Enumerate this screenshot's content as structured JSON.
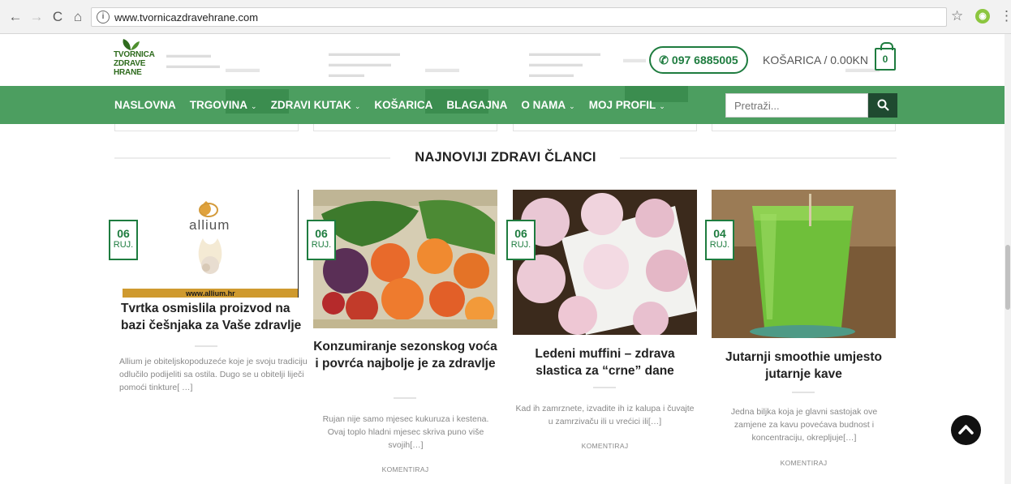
{
  "browser": {
    "url": "www.tvornicazdravehrane.com"
  },
  "header": {
    "logo_lines": [
      "TVORNICA",
      "ZDRAVE",
      "HRANE"
    ],
    "phone": "097 6885005",
    "cart_label": "KOŠARICA / 0.00KN",
    "cart_count": "0"
  },
  "nav": {
    "items": [
      {
        "label": "NASLOVNA",
        "dropdown": false
      },
      {
        "label": "TRGOVINA",
        "dropdown": true
      },
      {
        "label": "ZDRAVI KUTAK",
        "dropdown": true
      },
      {
        "label": "KOŠARICA",
        "dropdown": false
      },
      {
        "label": "BLAGAJNA",
        "dropdown": false
      },
      {
        "label": "O NAMA",
        "dropdown": true
      },
      {
        "label": "MOJ PROFIL",
        "dropdown": true
      }
    ],
    "search_placeholder": "Pretraži..."
  },
  "section": {
    "title": "NAJNOVIJI ZDRAVI ČLANCI"
  },
  "articles": [
    {
      "day": "06",
      "month": "RUJ.",
      "image_logo": "allium",
      "image_caption": "www.allium.hr",
      "title": "Tvrtka osmislila proizvod na bazi češnjaka za Vaše zdravlje",
      "excerpt": "Allium je obiteljskopoduzeće koje je svoju tradiciju odlučilo podijeliti sa ostila. Dugo se u obitelji liječi pomoći tinkture[ …]",
      "comment": ""
    },
    {
      "day": "06",
      "month": "RUJ.",
      "title": "Konzumiranje sezonskog voća i povrća najbolje je za zdravlje",
      "excerpt": "Rujan nije samo mjesec kukuruza i kestena. Ovaj toplo hladni mjesec skriva puno više svojih[…]",
      "comment": "KOMENTIRAJ"
    },
    {
      "day": "06",
      "month": "RUJ.",
      "title": "Ledeni muffini – zdrava slastica za “crne” dane",
      "excerpt": "Kad ih zamrznete, izvadite ih iz kalupa i čuvajte u zamrzivaču ili u vrećici ili[…]",
      "comment": "KOMENTIRAJ"
    },
    {
      "day": "04",
      "month": "RUJ.",
      "title": "Jutarnji smoothie umjesto jutarnje kave",
      "excerpt": "Jedna biljka koja je glavni sastojak ove zamjene za kavu povećava budnost i koncentraciju, okrepljuje[…]",
      "comment": "KOMENTIRAJ"
    }
  ],
  "colors": {
    "brand_green": "#1e7c3f",
    "nav_green": "#4c9e60",
    "search_btn": "#1f4a30"
  }
}
